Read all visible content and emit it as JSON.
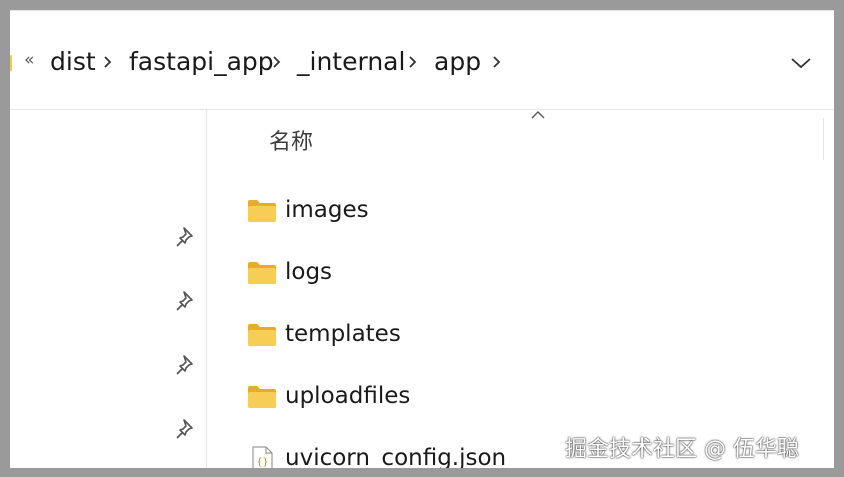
{
  "breadcrumb": {
    "overflow": "«",
    "items": [
      "dist",
      "fastapi_app",
      "_internal",
      "app"
    ]
  },
  "column_header": {
    "name": "名称"
  },
  "files": [
    {
      "name": "images",
      "type": "folder"
    },
    {
      "name": "logs",
      "type": "folder"
    },
    {
      "name": "templates",
      "type": "folder"
    },
    {
      "name": "uploadfiles",
      "type": "folder"
    },
    {
      "name": "uvicorn_config.json",
      "type": "json-file"
    }
  ],
  "quick_access": {
    "pins": [
      "pin-icon",
      "pin-icon",
      "pin-icon",
      "pin-icon"
    ]
  },
  "icons": {
    "separator": "chevron-right-icon",
    "expand": "chevron-down-icon",
    "sort": "sort-ascending-icon",
    "folder": "folder-icon",
    "json": "json-file-icon"
  },
  "colors": {
    "frame": "#9a9a9a",
    "background": "#ffffff",
    "folder": "#f2c94c",
    "text": "#1a1a1a"
  },
  "watermark": "掘金技术社区 @ 伍华聪"
}
